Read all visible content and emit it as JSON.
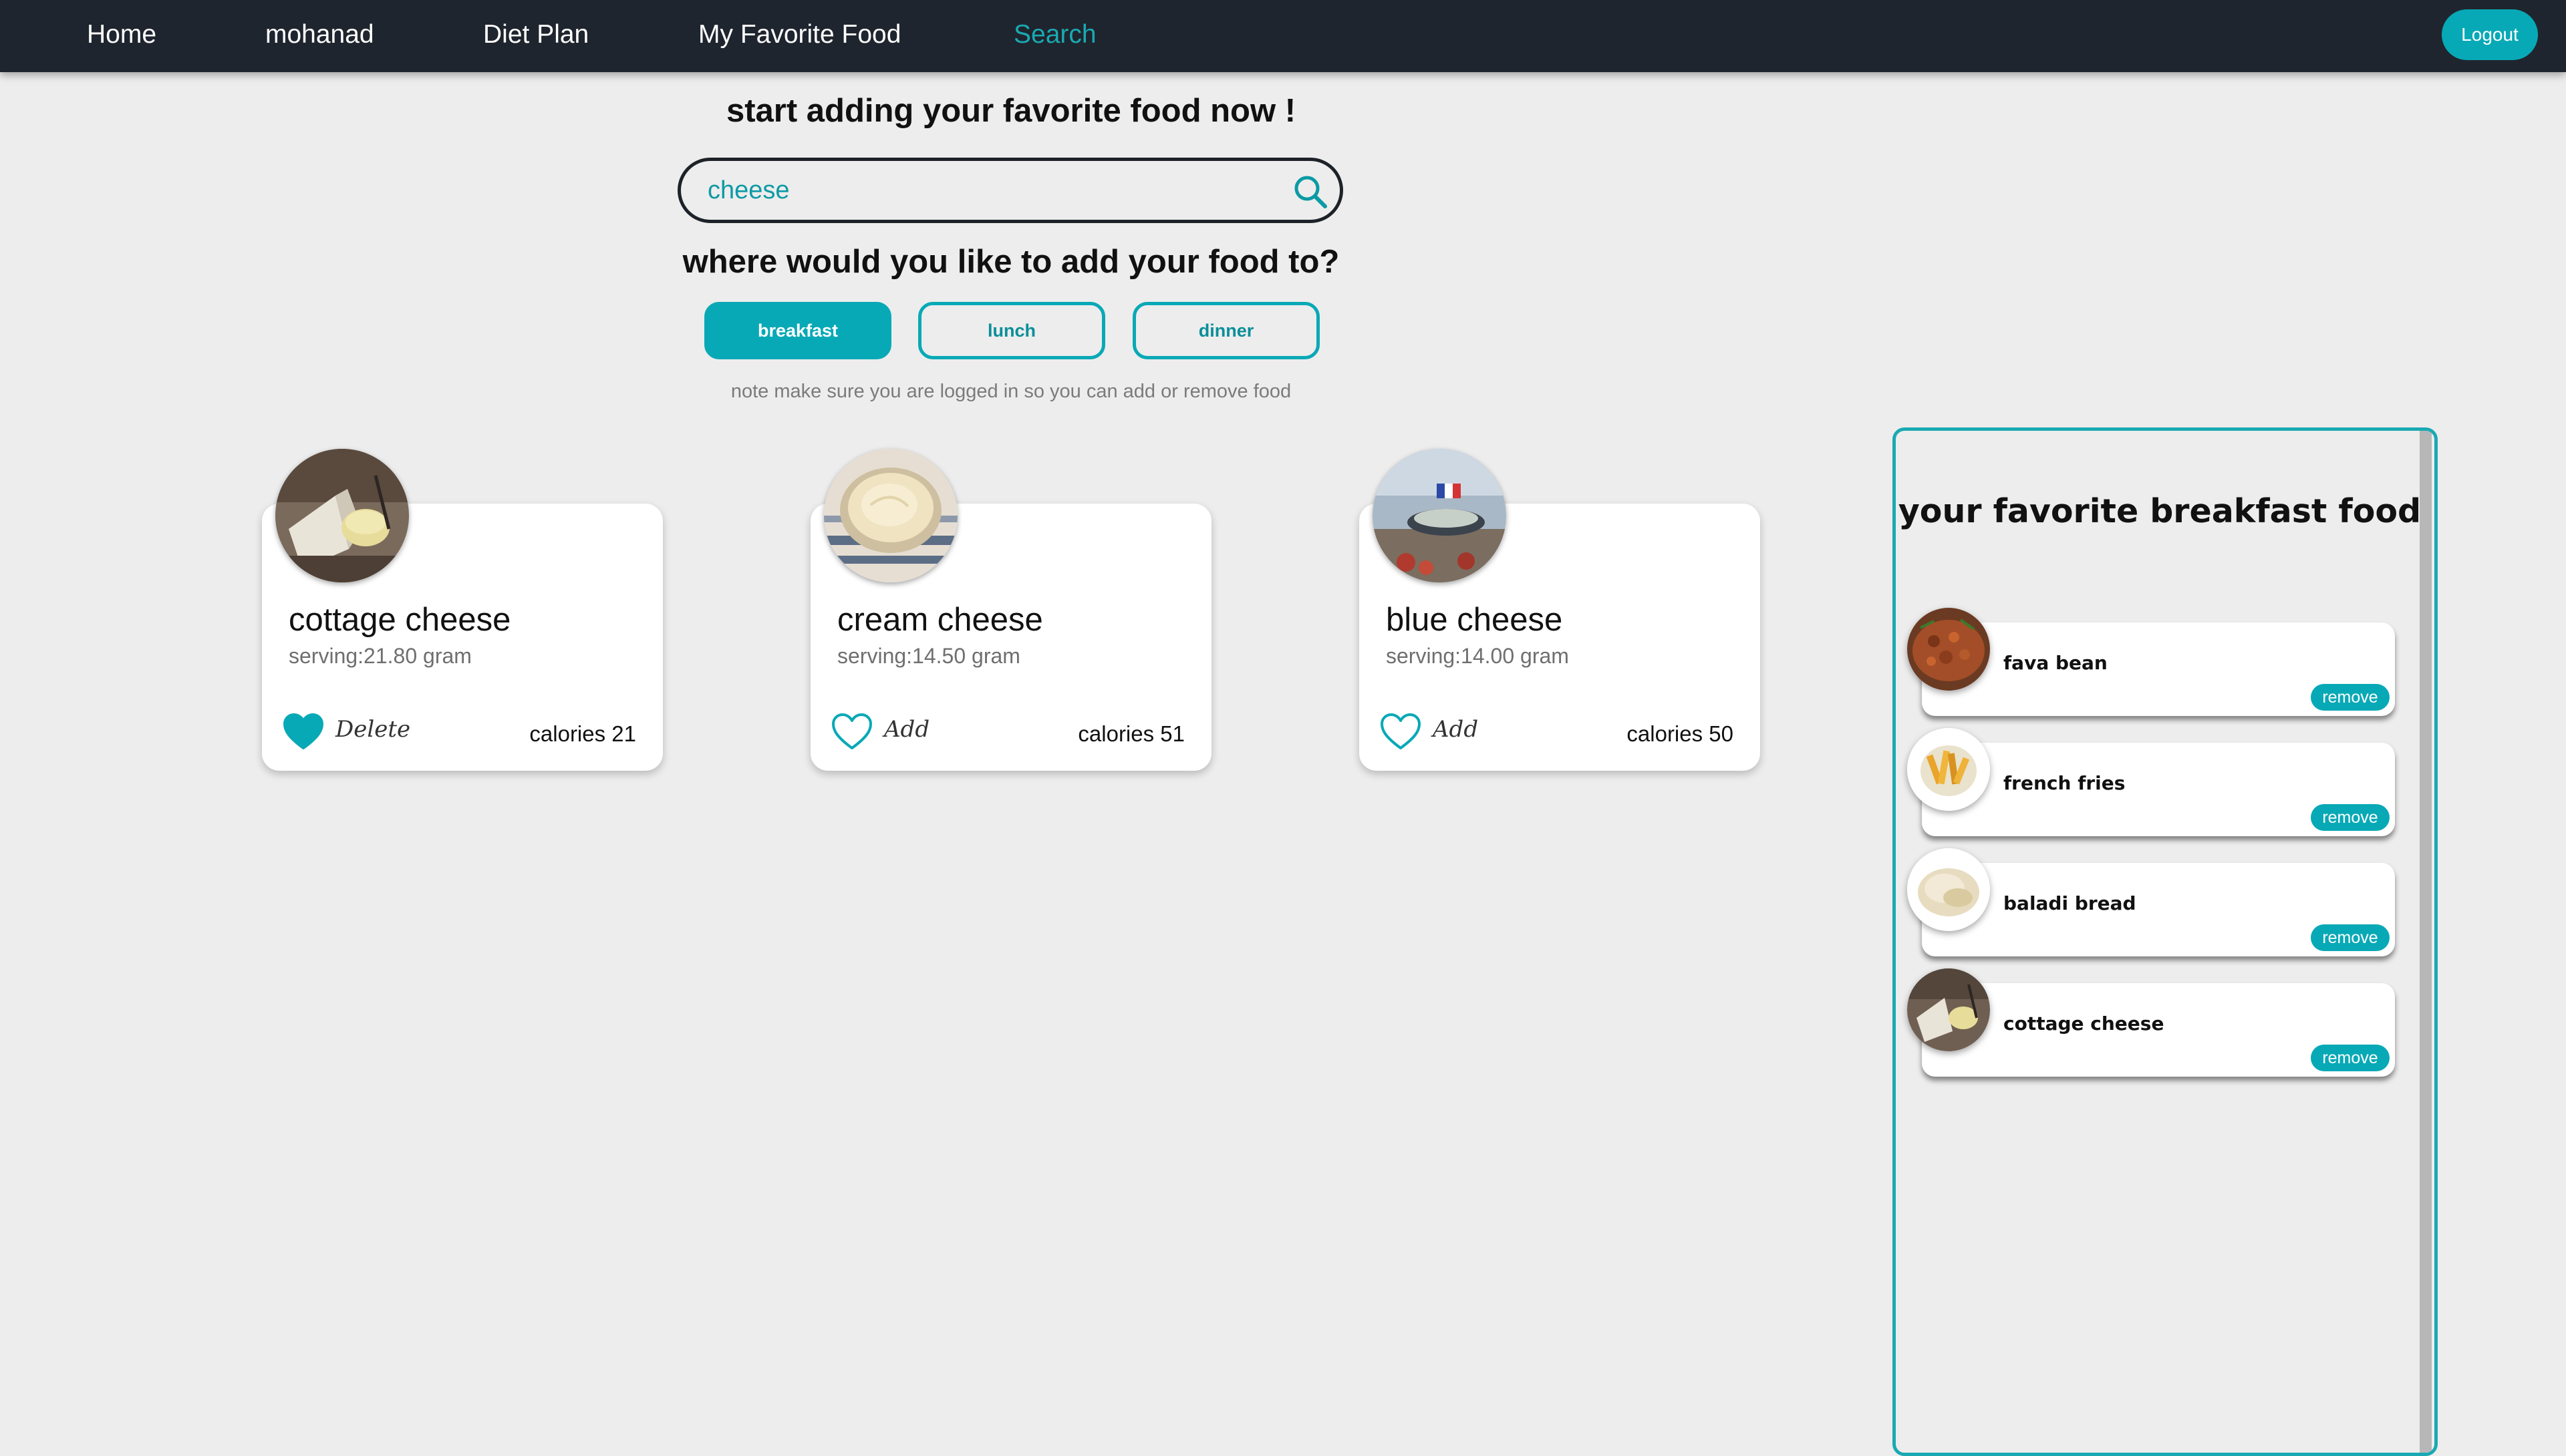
{
  "nav": {
    "items": [
      {
        "label": "Home"
      },
      {
        "label": "mohanad"
      },
      {
        "label": "Diet Plan"
      },
      {
        "label": "My Favorite Food"
      },
      {
        "label": "Search",
        "active": true
      }
    ],
    "logout_label": "Logout"
  },
  "search": {
    "heading": "start adding your favorite food now !",
    "query": "cheese",
    "meal_question": "where would you like to add your food to?",
    "meals": [
      {
        "label": "breakfast",
        "selected": true
      },
      {
        "label": "lunch",
        "selected": false
      },
      {
        "label": "dinner",
        "selected": false
      }
    ],
    "note": "note make sure you are logged in so you can add or remove food"
  },
  "results": [
    {
      "name": "cottage cheese",
      "serving": "serving:21.80 gram",
      "action": "Delete",
      "favorited": true,
      "calories": "calories 21",
      "image": "cottage-cheese-photo"
    },
    {
      "name": "cream cheese",
      "serving": "serving:14.50 gram",
      "action": "Add",
      "favorited": false,
      "calories": "calories 51",
      "image": "cream-cheese-photo"
    },
    {
      "name": "blue cheese",
      "serving": "serving:14.00 gram",
      "action": "Add",
      "favorited": false,
      "calories": "calories 50",
      "image": "blue-cheese-photo"
    }
  ],
  "favorites_panel": {
    "title": "your favorite breakfast food",
    "items": [
      {
        "name": "fava bean",
        "image": "fava-bean-photo"
      },
      {
        "name": "french fries",
        "image": "french-fries-photo"
      },
      {
        "name": "baladi bread",
        "image": "baladi-bread-photo"
      },
      {
        "name": "cottage cheese",
        "image": "cottage-cheese-photo"
      }
    ],
    "remove_label": "remove"
  },
  "colors": {
    "accent": "#08a9b6",
    "navbar": "#1f252e",
    "background": "#ededed"
  }
}
